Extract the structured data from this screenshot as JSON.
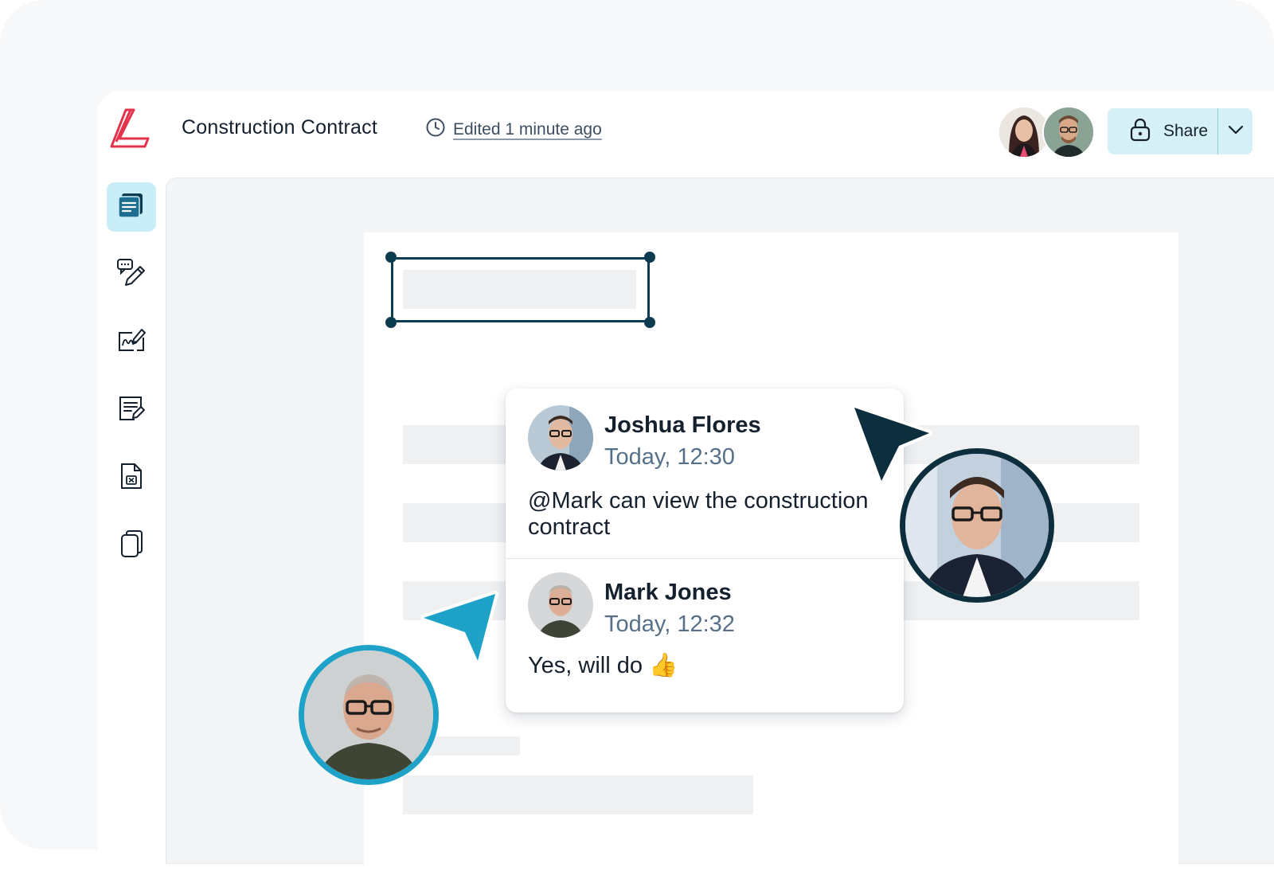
{
  "header": {
    "document_title": "Construction Contract",
    "edited_status": "Edited 1 minute ago",
    "share_label": "Share"
  },
  "icons": {
    "logo": "app-logo",
    "clock": "clock-icon",
    "lock": "lock-icon",
    "caret": "chevron-down-icon",
    "sidebar": [
      "documents-icon",
      "comment-edit-icon",
      "signature-icon",
      "form-edit-icon",
      "file-excel-icon",
      "copy-icon"
    ]
  },
  "comments": [
    {
      "author": "Joshua Flores",
      "time": "Today, 12:30",
      "mention": "@Mark",
      "text": " can view the construction contract"
    },
    {
      "author": "Mark Jones",
      "time": "Today, 12:32",
      "text": "Yes, will do 👍"
    }
  ],
  "colors": {
    "brand_red": "#e3324a",
    "accent_teal": "#1fa2c7",
    "dark_navy": "#0d3b4f",
    "share_bg": "#d5f0f7"
  }
}
